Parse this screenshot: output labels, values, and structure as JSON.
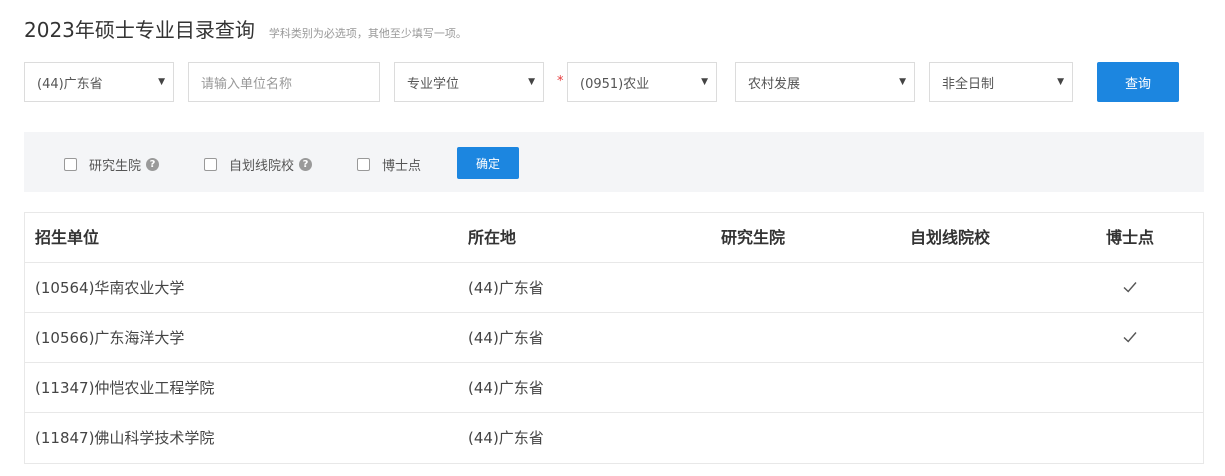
{
  "header": {
    "title": "2023年硕士专业目录查询",
    "hint": "学科类别为必选项，其他至少填写一项。"
  },
  "search": {
    "province": "(44)广东省",
    "unit_placeholder": "请输入单位名称",
    "degree_type": "专业学位",
    "required_mark": "*",
    "discipline": "(0951)农业",
    "major": "农村发展",
    "study_mode": "非全日制",
    "query_label": "查询"
  },
  "filters": {
    "options": [
      {
        "label": "研究生院",
        "has_help": true
      },
      {
        "label": "自划线院校",
        "has_help": true
      },
      {
        "label": "博士点",
        "has_help": false
      }
    ],
    "help_glyph": "?",
    "confirm_label": "确定"
  },
  "table": {
    "headers": [
      "招生单位",
      "所在地",
      "研究生院",
      "自划线院校",
      "博士点"
    ],
    "rows": [
      {
        "unit": "(10564)华南农业大学",
        "location": "(44)广东省",
        "grad_school": false,
        "self_line": false,
        "doctoral": true
      },
      {
        "unit": "(10566)广东海洋大学",
        "location": "(44)广东省",
        "grad_school": false,
        "self_line": false,
        "doctoral": true
      },
      {
        "unit": "(11347)仲恺农业工程学院",
        "location": "(44)广东省",
        "grad_school": false,
        "self_line": false,
        "doctoral": false
      },
      {
        "unit": "(11847)佛山科学技术学院",
        "location": "(44)广东省",
        "grad_school": false,
        "self_line": false,
        "doctoral": false
      }
    ]
  },
  "icons": {
    "caret": "caret-down-icon",
    "check": "check-icon",
    "help": "question-circle-icon"
  },
  "colors": {
    "primary": "#1c86e0",
    "required": "#e5393b",
    "panel_bg": "#f4f5f7"
  }
}
